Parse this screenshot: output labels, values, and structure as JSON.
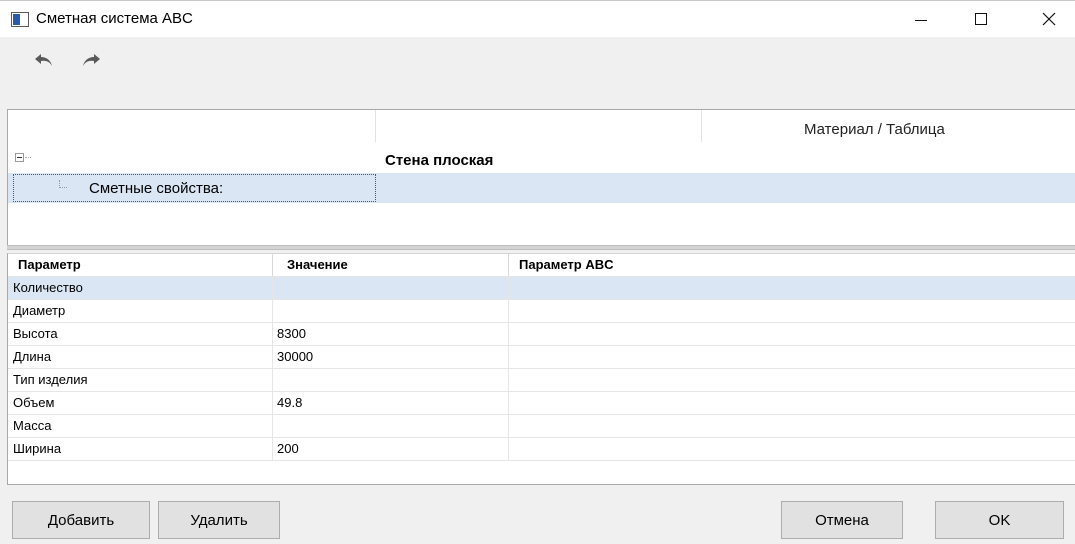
{
  "window": {
    "title": "Сметная система ABC",
    "icons": {
      "app": "app-window-icon",
      "minimize": "minimize-icon",
      "maximize": "maximize-icon",
      "close": "close-icon"
    }
  },
  "toolbar": {
    "icons": {
      "undo": "undo-arrow-icon",
      "redo": "redo-arrow-icon"
    }
  },
  "properties": {
    "column_header": "Материал / Таблица",
    "group_title": "Стена плоская",
    "selected_item": "Сметные свойства:"
  },
  "grid": {
    "headers": [
      "Параметр",
      "Значение",
      "Параметр ABC"
    ],
    "rows": [
      {
        "param": "Количество",
        "value": "",
        "abc": ""
      },
      {
        "param": "Диаметр",
        "value": "",
        "abc": ""
      },
      {
        "param": "Высота",
        "value": "8300",
        "abc": ""
      },
      {
        "param": "Длина",
        "value": "30000",
        "abc": ""
      },
      {
        "param": "Тип изделия",
        "value": "",
        "abc": ""
      },
      {
        "param": "Объем",
        "value": "49.8",
        "abc": ""
      },
      {
        "param": "Масса",
        "value": "",
        "abc": ""
      },
      {
        "param": "Ширина",
        "value": "200",
        "abc": ""
      }
    ],
    "selected_row": 0
  },
  "buttons": {
    "add": "Добавить",
    "delete": "Удалить",
    "cancel": "Отмена",
    "ok": "OK"
  },
  "colors": {
    "selection": "#dbe6f4",
    "window_bg": "#f0f0f0",
    "button_bg": "#e1e1e1"
  }
}
